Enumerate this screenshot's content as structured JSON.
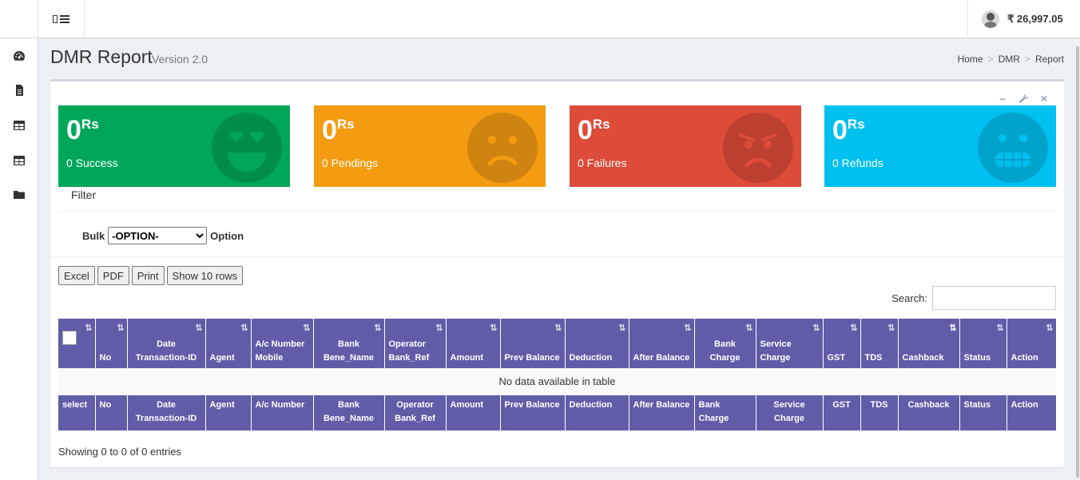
{
  "header": {
    "menu_toggle_icon": "bars-icon",
    "balance": "₹ 26,997.05",
    "avatar_icon": "user-avatar"
  },
  "sidebar": {
    "items": [
      {
        "icon": "dashboard-icon"
      },
      {
        "icon": "file-icon"
      },
      {
        "icon": "table-icon"
      },
      {
        "icon": "table-icon"
      },
      {
        "icon": "folder-icon"
      }
    ]
  },
  "page": {
    "title": "DMR Report",
    "subtitle": "Version 2.0",
    "breadcrumb": [
      "Home",
      "DMR",
      "Report"
    ]
  },
  "box": {
    "tools": {
      "collapse": "–",
      "settings_icon": "wrench-icon",
      "close": "×"
    }
  },
  "stats": [
    {
      "amount": "0",
      "unit": "Rs",
      "label": "0 Success",
      "color": "#00a65a",
      "icon": "heart-eyes-icon"
    },
    {
      "amount": "0",
      "unit": "Rs",
      "label": "0 Pendings",
      "color": "#f39c12",
      "icon": "frown-icon"
    },
    {
      "amount": "0",
      "unit": "Rs",
      "label": "0 Failures",
      "color": "#dd4b39",
      "icon": "angry-icon"
    },
    {
      "amount": "0",
      "unit": "Rs",
      "label": "0 Refunds",
      "color": "#00c0ef",
      "icon": "grimace-icon"
    }
  ],
  "filter": {
    "label": "Filter",
    "bulk_label": "Bulk",
    "bulk_selected": "-OPTION-",
    "option_label": "Option"
  },
  "table": {
    "buttons": [
      "Excel",
      "PDF",
      "Print",
      "Show 10 rows"
    ],
    "search_label": "Search:",
    "header": [
      "",
      "No",
      "Date Transaction-ID",
      "Agent",
      "A/c Number Mobile",
      "Bank Bene_Name",
      "Operator Bank_Ref",
      "Amount",
      "Prev Balance",
      "Deduction",
      "After Balance",
      "Bank Charge",
      "Service Charge",
      "GST",
      "TDS",
      "Cashback",
      "Status",
      "Action"
    ],
    "empty_message": "No data available in table",
    "footer": [
      "select",
      "No",
      "Date Transaction-ID",
      "Agent",
      "A/c Number",
      "Bank Bene_Name",
      "Operator Bank_Ref",
      "Amount",
      "Prev Balance",
      "Deduction",
      "After Balance",
      "Bank Charge",
      "Service Charge",
      "GST",
      "TDS",
      "Cashback",
      "Status",
      "Action"
    ],
    "info": "Showing 0 to 0 of 0 entries",
    "header_color": "#605ca8"
  }
}
